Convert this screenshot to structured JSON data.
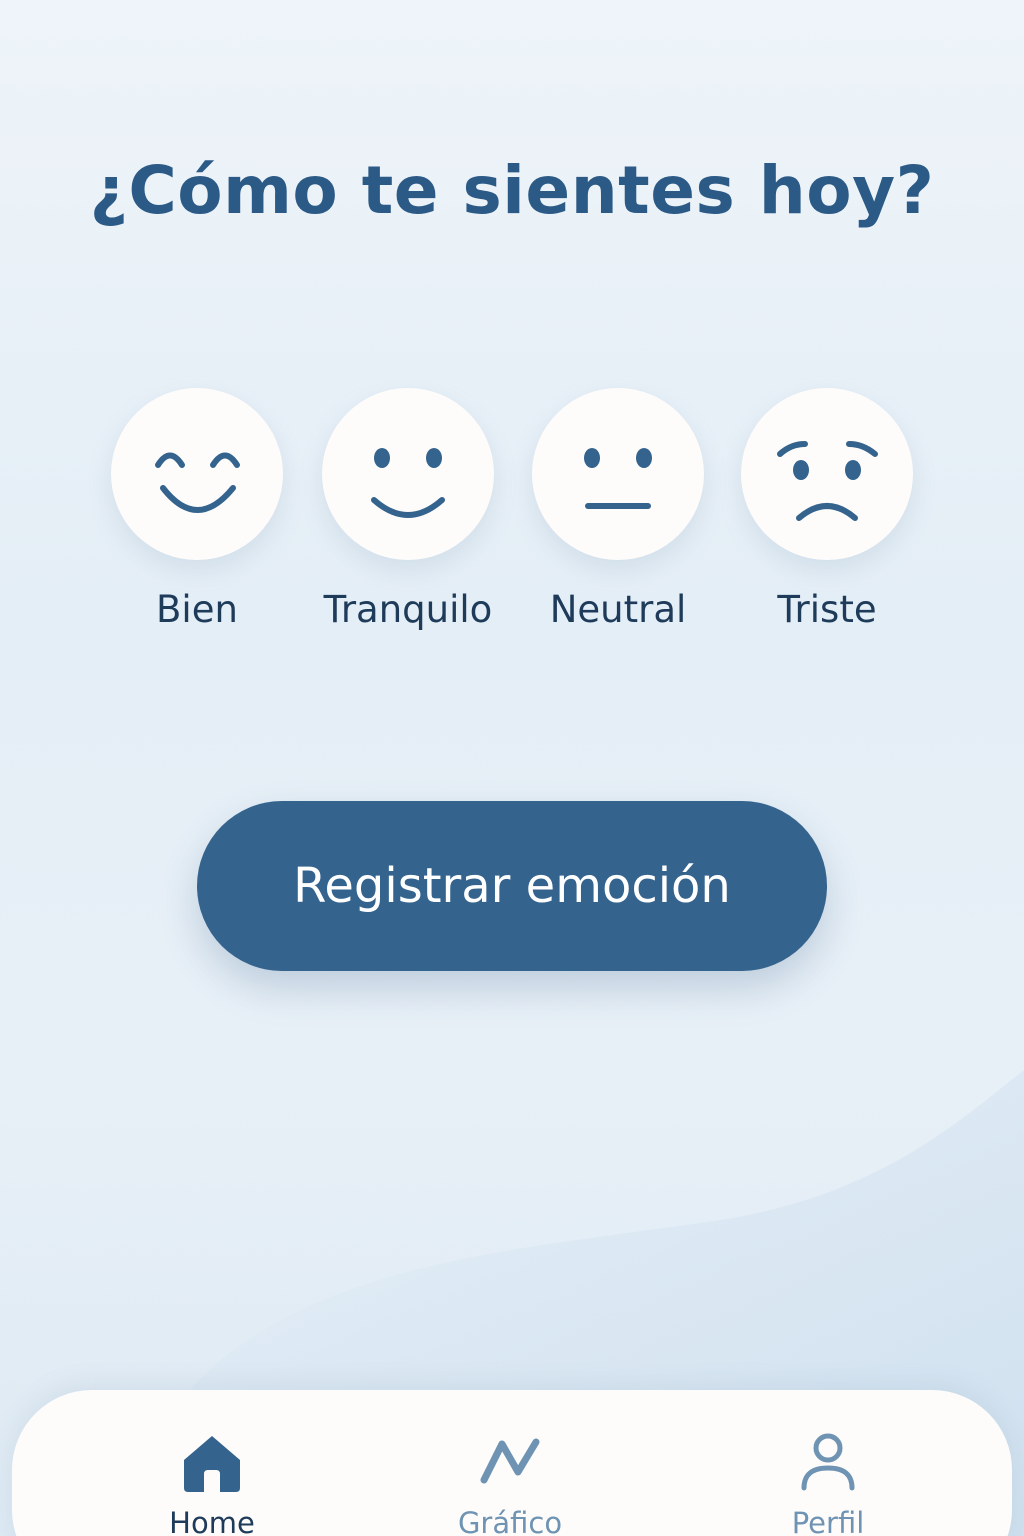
{
  "colors": {
    "primary": "#34638e",
    "title": "#2c5a86",
    "text_dark": "#1f3b5a",
    "icon_inactive": "#6f93b3",
    "face_bg": "#fdfcfa"
  },
  "header": {
    "title": "¿Cómo te sientes hoy?"
  },
  "moods": [
    {
      "label": "Bien",
      "icon": "happy-face-icon"
    },
    {
      "label": "Tranquilo",
      "icon": "smile-face-icon"
    },
    {
      "label": "Neutral",
      "icon": "neutral-face-icon"
    },
    {
      "label": "Triste",
      "icon": "sad-face-icon"
    }
  ],
  "action": {
    "register_label": "Registrar emoción"
  },
  "nav": {
    "active": "Home",
    "items": [
      {
        "label": "Home",
        "icon": "home-icon"
      },
      {
        "label": "Gráfico",
        "icon": "chart-line-icon"
      },
      {
        "label": "Perfil",
        "icon": "user-icon"
      }
    ]
  }
}
